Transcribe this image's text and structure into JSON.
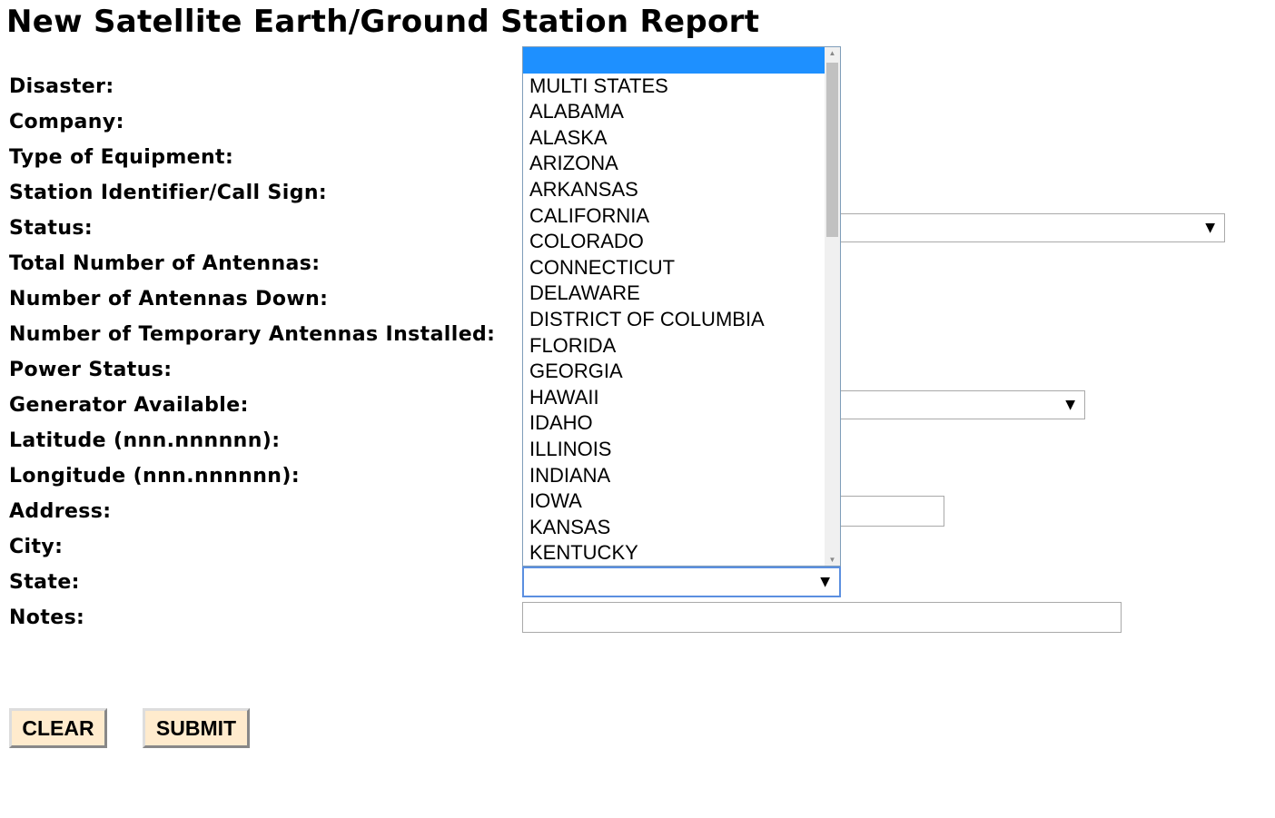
{
  "title": "New Satellite Earth/Ground Station Report",
  "labels": [
    "Disaster:",
    "Company:",
    "Type of Equipment:",
    "Station Identifier/Call Sign:",
    "Status:",
    "Total Number of Antennas:",
    "Number of Antennas Down:",
    "Number of Temporary Antennas Installed:",
    "Power Status:",
    "Generator Available:",
    "Latitude (nnn.nnnnnn):",
    "Longitude (nnn.nnnnnn):",
    "Address:",
    "City:",
    "State:",
    "Notes:"
  ],
  "state_dropdown": {
    "selected": "",
    "options": [
      "",
      "MULTI STATES",
      "ALABAMA",
      "ALASKA",
      "ARIZONA",
      "ARKANSAS",
      "CALIFORNIA",
      "COLORADO",
      "CONNECTICUT",
      "DELAWARE",
      "DISTRICT OF COLUMBIA",
      "FLORIDA",
      "GEORGIA",
      "HAWAII",
      "IDAHO",
      "ILLINOIS",
      "INDIANA",
      "IOWA",
      "KANSAS",
      "KENTUCKY"
    ]
  },
  "buttons": {
    "clear": "CLEAR",
    "submit": "SUBMIT"
  }
}
